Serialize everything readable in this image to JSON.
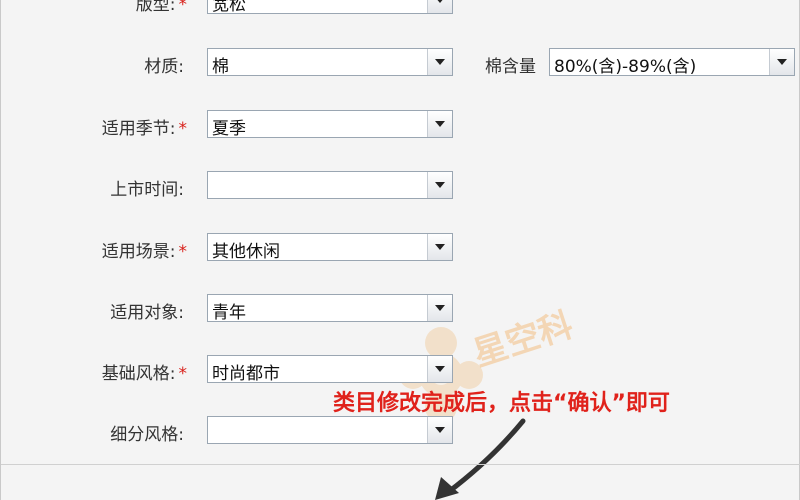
{
  "form": {
    "fields": [
      {
        "label": "版型:",
        "required": "*",
        "value": "宽松"
      },
      {
        "label": "材质:",
        "required": "",
        "value": "棉"
      },
      {
        "label": "适用季节:",
        "required": "*",
        "value": "夏季"
      },
      {
        "label": "上市时间:",
        "required": "",
        "value": ""
      },
      {
        "label": "适用场景:",
        "required": "*",
        "value": "其他休闲"
      },
      {
        "label": "适用对象:",
        "required": "",
        "value": "青年"
      },
      {
        "label": "基础风格:",
        "required": "*",
        "value": "时尚都市"
      },
      {
        "label": "细分风格:",
        "required": "",
        "value": ""
      }
    ],
    "cotton_content": {
      "label": "棉含量",
      "value": "80%(含)-89%(含)"
    }
  },
  "annotation": {
    "text": "类目修改完成后，点击“确认”即可",
    "color": "#e0221b"
  },
  "watermark": {
    "text": "星空科"
  },
  "colors": {
    "required": "#d8201a",
    "border": "#9aa6b2",
    "background": "#f4f4f4"
  }
}
